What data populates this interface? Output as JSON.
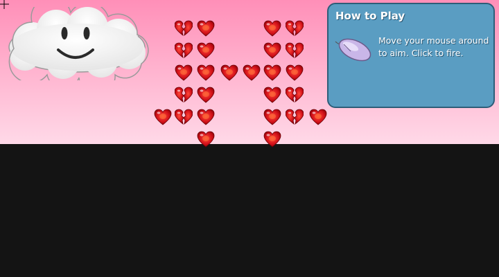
{
  "game": {
    "hearts": [
      {
        "row": 0,
        "col": 1,
        "state": "broken"
      },
      {
        "row": 0,
        "col": 2,
        "state": "whole"
      },
      {
        "row": 0,
        "col": 6,
        "state": "whole"
      },
      {
        "row": 0,
        "col": 7,
        "state": "broken"
      },
      {
        "row": 1,
        "col": 1,
        "state": "broken"
      },
      {
        "row": 1,
        "col": 2,
        "state": "whole"
      },
      {
        "row": 1,
        "col": 6,
        "state": "whole"
      },
      {
        "row": 1,
        "col": 7,
        "state": "broken"
      },
      {
        "row": 2,
        "col": 1,
        "state": "whole"
      },
      {
        "row": 2,
        "col": 2,
        "state": "whole"
      },
      {
        "row": 2,
        "col": 3,
        "state": "whole"
      },
      {
        "row": 2,
        "col": 4,
        "state": "whole"
      },
      {
        "row": 2,
        "col": 5,
        "state": "whole"
      },
      {
        "row": 2,
        "col": 6,
        "state": "whole"
      },
      {
        "row": 3,
        "col": 1,
        "state": "broken"
      },
      {
        "row": 3,
        "col": 2,
        "state": "whole"
      },
      {
        "row": 3,
        "col": 6,
        "state": "whole"
      },
      {
        "row": 3,
        "col": 7,
        "state": "broken"
      },
      {
        "row": 4,
        "col": 0,
        "state": "whole"
      },
      {
        "row": 4,
        "col": 1,
        "state": "broken"
      },
      {
        "row": 4,
        "col": 2,
        "state": "whole"
      },
      {
        "row": 4,
        "col": 6,
        "state": "whole"
      },
      {
        "row": 4,
        "col": 7,
        "state": "broken"
      },
      {
        "row": 4,
        "col": 8,
        "state": "whole"
      },
      {
        "row": 5,
        "col": 2,
        "state": "whole"
      },
      {
        "row": 5,
        "col": 6,
        "state": "whole"
      }
    ],
    "colors": {
      "sky_top": "#ff8fb8",
      "sky_bottom": "#ffd9e8",
      "ground": "#141414",
      "heart": "#d4121a",
      "panel": "#5a9dc2"
    },
    "icons": {
      "cursor": "crosshair-icon",
      "player": "smiley-cloud",
      "help": "computer-mouse-icon"
    }
  },
  "help_panel": {
    "title": "How to Play",
    "text": "Move your mouse around to aim. Click to fire."
  }
}
